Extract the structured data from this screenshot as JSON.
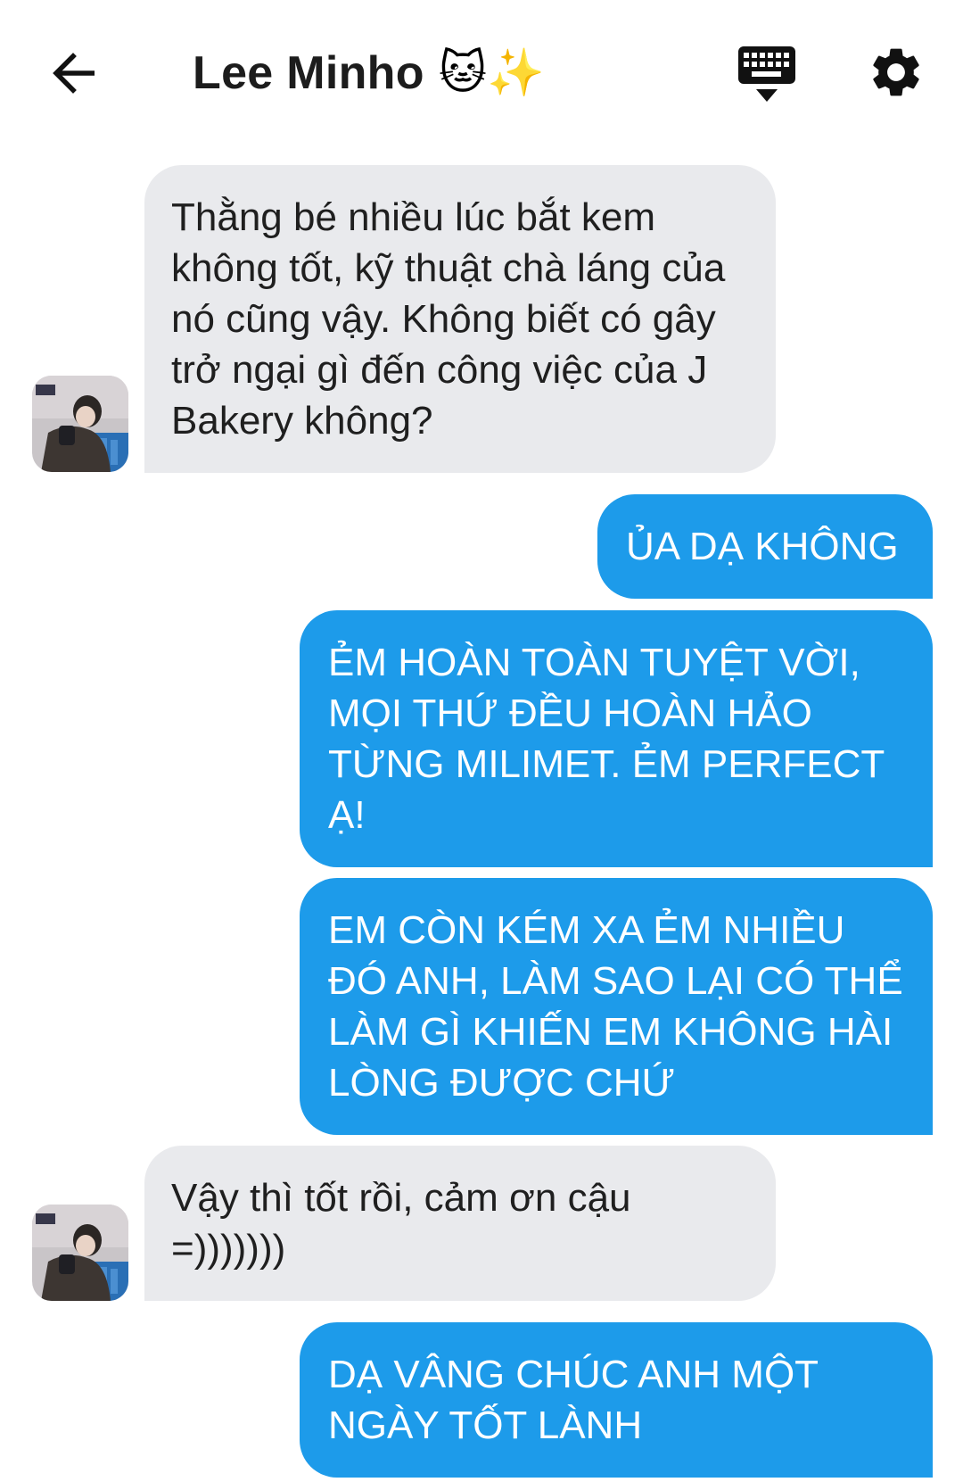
{
  "header": {
    "title": "Lee Minho",
    "title_emojis": "🐱✨",
    "back_icon": "arrow-left-icon",
    "keyboard_icon": "keyboard-icon",
    "settings_icon": "gear-icon"
  },
  "colors": {
    "incoming_bubble": "#e9eaed",
    "outgoing_bubble": "#1d9bea",
    "outgoing_text": "#ffffff",
    "incoming_text": "#1f1f1f"
  },
  "messages": [
    {
      "direction": "incoming",
      "text": "Thằng bé nhiều lúc bắt kem không tốt, kỹ thuật chà láng của nó cũng vậy. Không biết có gây trở ngại gì đến công việc của J Bakery không?"
    },
    {
      "direction": "outgoing",
      "text": "ỦA DẠ KHÔNG"
    },
    {
      "direction": "outgoing",
      "text": "ẺM HOÀN TOÀN TUYỆT VỜI, MỌI THỨ ĐỀU HOÀN HẢO TỪNG MILIMET. ẺM PERFECT Ạ!"
    },
    {
      "direction": "outgoing",
      "text": "EM CÒN KÉM XA ẺM NHIỀU ĐÓ ANH, LÀM SAO LẠI CÓ THỂ LÀM GÌ KHIẾN EM KHÔNG HÀI LÒNG ĐƯỢC CHỨ"
    },
    {
      "direction": "incoming",
      "text": "Vậy thì tốt rồi, cảm ơn cậu =)))))))"
    },
    {
      "direction": "outgoing",
      "text": "DẠ VÂNG CHÚC ANH MỘT NGÀY TỐT LÀNH"
    }
  ]
}
